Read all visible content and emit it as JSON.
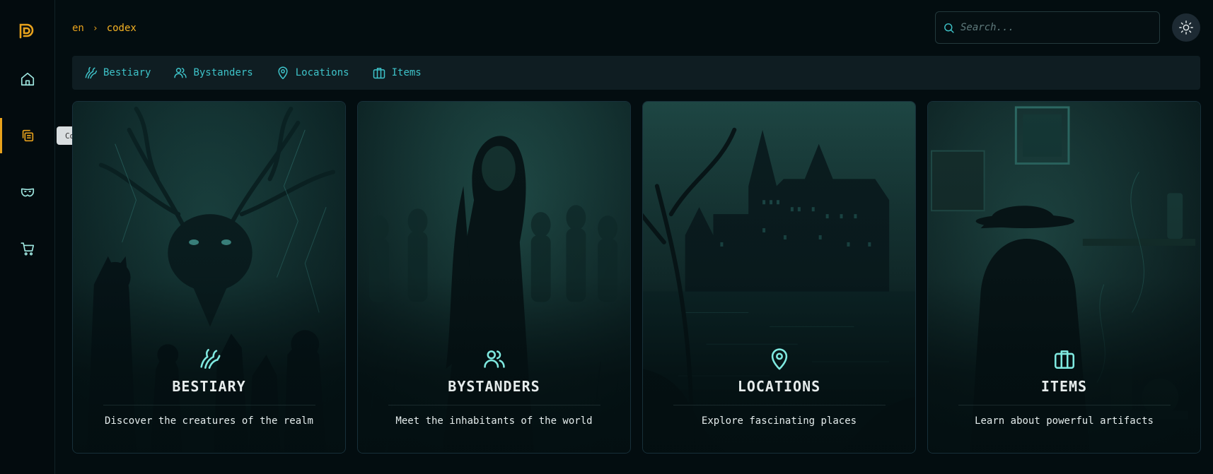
{
  "breadcrumb": {
    "root": "en",
    "separator": "›",
    "current": "codex"
  },
  "search": {
    "placeholder": "Search...",
    "value": ""
  },
  "sidebar": {
    "items": [
      {
        "name": "home",
        "icon": "home-icon"
      },
      {
        "name": "codex",
        "icon": "codex-icon",
        "active": true
      },
      {
        "name": "masks",
        "icon": "mask-icon"
      },
      {
        "name": "shop",
        "icon": "cart-icon"
      }
    ],
    "tooltip": "Codex"
  },
  "tabs": [
    {
      "label": "Bestiary",
      "icon": "claw-icon"
    },
    {
      "label": "Bystanders",
      "icon": "users-icon"
    },
    {
      "label": "Locations",
      "icon": "map-pin-icon"
    },
    {
      "label": "Items",
      "icon": "briefcase-icon"
    }
  ],
  "cards": [
    {
      "title": "BESTIARY",
      "description": "Discover the creatures of the realm",
      "icon": "claw-icon"
    },
    {
      "title": "BYSTANDERS",
      "description": "Meet the inhabitants of the world",
      "icon": "users-icon"
    },
    {
      "title": "LOCATIONS",
      "description": "Explore fascinating places",
      "icon": "map-pin-icon"
    },
    {
      "title": "ITEMS",
      "description": "Learn about powerful artifacts",
      "icon": "briefcase-icon"
    }
  ],
  "colors": {
    "accent": "#e8a21c",
    "teal": "#3ec3c9",
    "background": "#030d10",
    "panel": "#0f1d22"
  }
}
